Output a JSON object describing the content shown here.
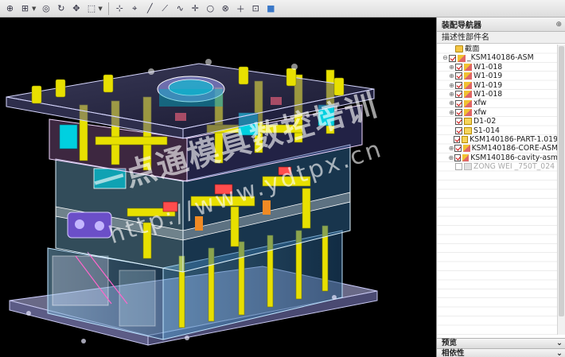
{
  "toolbar": {
    "icons": [
      "select-icon",
      "select-dropdown-icon",
      "zoom-icon",
      "rotate-icon",
      "pan-icon",
      "view-icon",
      "fit-icon",
      "snap-icon",
      "line-icon",
      "constraint-icon",
      "curve-icon",
      "point-icon",
      "circle-icon",
      "target-icon",
      "plus-icon",
      "assembly-icon",
      "cube-icon"
    ]
  },
  "watermark": {
    "chinese": "一点通模具数控培训",
    "url": "http://www.ydtpx.cn"
  },
  "panel": {
    "title": "装配导航器",
    "column_header": "描述性部件名",
    "tree": [
      {
        "label": "截面",
        "type": "folder",
        "expand": "",
        "checked": false,
        "indent": 1
      },
      {
        "label": "_KSM140186-ASM",
        "type": "asm",
        "expand": "⊖",
        "checked": true,
        "indent": 0
      },
      {
        "label": "W1-018",
        "type": "asm",
        "expand": "⊕",
        "checked": true,
        "indent": 1
      },
      {
        "label": "W1-019",
        "type": "asm",
        "expand": "⊕",
        "checked": true,
        "indent": 1
      },
      {
        "label": "W1-019",
        "type": "asm",
        "expand": "⊕",
        "checked": true,
        "indent": 1
      },
      {
        "label": "W1-018",
        "type": "asm",
        "expand": "⊕",
        "checked": true,
        "indent": 1
      },
      {
        "label": "xfw",
        "type": "asm",
        "expand": "⊕",
        "checked": true,
        "indent": 1
      },
      {
        "label": "xfw",
        "type": "asm",
        "expand": "⊕",
        "checked": true,
        "indent": 1
      },
      {
        "label": "D1-02",
        "type": "part",
        "expand": "",
        "checked": true,
        "indent": 1
      },
      {
        "label": "S1-014",
        "type": "part",
        "expand": "",
        "checked": true,
        "indent": 1
      },
      {
        "label": "KSM140186-PART-1.019",
        "type": "part",
        "expand": "",
        "checked": true,
        "indent": 1
      },
      {
        "label": "KSM140186-CORE-ASM",
        "type": "asm",
        "expand": "⊕",
        "checked": true,
        "indent": 1
      },
      {
        "label": "KSM140186-cavity-asm",
        "type": "asm",
        "expand": "⊕",
        "checked": true,
        "indent": 1
      },
      {
        "label": "ZONG WEI _750T_024",
        "type": "ghost",
        "expand": "",
        "checked": false,
        "indent": 1
      }
    ],
    "sections": {
      "preview": "预览",
      "dependencies": "相依性"
    }
  },
  "colors": {
    "viewport_bg": "#000000",
    "plate_outline": "#c9c9ff",
    "yellow_parts": "#e8e000",
    "cyan_parts": "#00c8d8",
    "check_red": "#cc0000"
  }
}
